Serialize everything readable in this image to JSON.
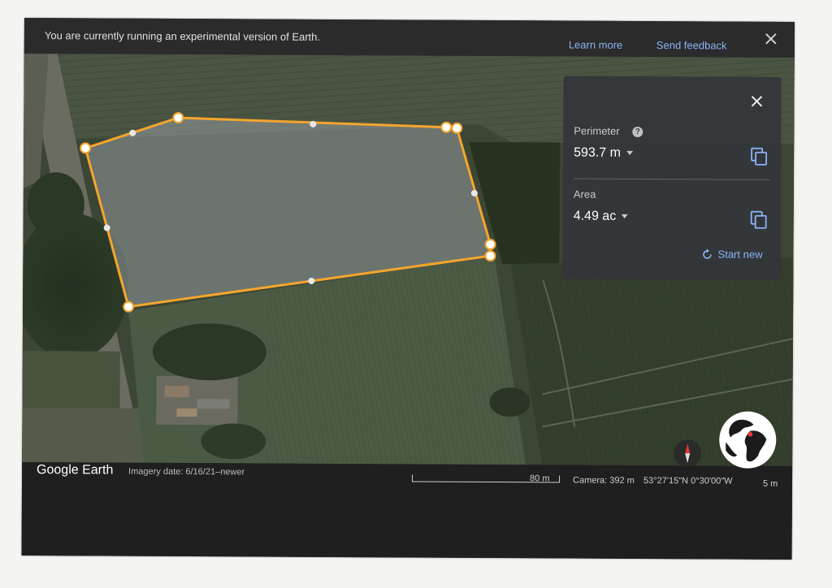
{
  "banner": {
    "message": "You are currently running an experimental version of Earth.",
    "learn_more": "Learn more",
    "send_feedback": "Send feedback"
  },
  "measure_panel": {
    "perimeter_label": "Perimeter",
    "help_glyph": "?",
    "perimeter_value": "593.7 m",
    "area_label": "Area",
    "area_value": "4.49 ac",
    "start_new": "Start new"
  },
  "status_bar": {
    "logo": "Google Earth",
    "imagery_date": "Imagery date: 6/16/21–newer",
    "scale_label": "80 m",
    "camera": "Camera: 392 m",
    "coordinates": "53°27'15\"N 0°30'00\"W",
    "elevation": "5 m"
  },
  "colors": {
    "polygon_outline": "#f4a52e",
    "link_blue": "#8ab4f8",
    "panel_bg": "#34363a"
  },
  "icons": [
    "close-icon",
    "help-icon",
    "copy-icon",
    "refresh-icon",
    "compass-icon",
    "globe-icon"
  ]
}
